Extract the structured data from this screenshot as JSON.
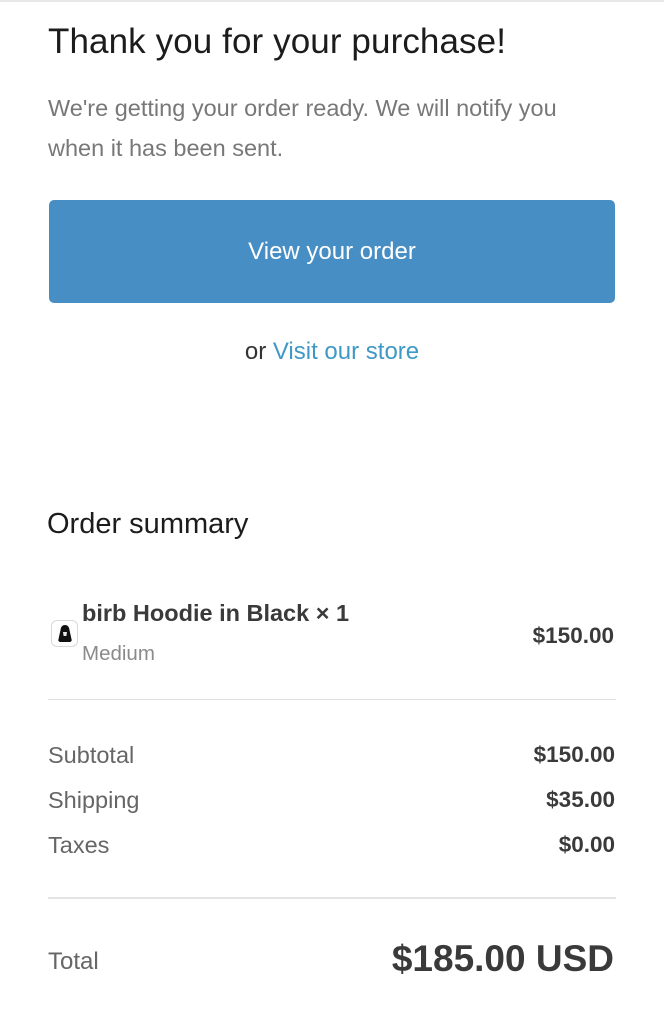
{
  "header": {
    "title": "Thank you for your purchase!",
    "message": "We're getting your order ready. We will notify you when it has been sent."
  },
  "actions": {
    "view_order_label": "View your order",
    "or_text": "or",
    "visit_store_label": "Visit our store"
  },
  "summary": {
    "title": "Order summary",
    "items": [
      {
        "name": "birb Hoodie in Black × 1",
        "variant": "Medium",
        "price": "$150.00",
        "thumbnail_icon": "hoodie-icon"
      }
    ],
    "lines": [
      {
        "label": "Subtotal",
        "value": "$150.00"
      },
      {
        "label": "Shipping",
        "value": "$35.00"
      },
      {
        "label": "Taxes",
        "value": "$0.00"
      }
    ],
    "total_label": "Total",
    "total_value": "$185.00 USD"
  },
  "colors": {
    "accent": "#478ec4",
    "link": "#3f98c6",
    "text_muted": "#787878"
  }
}
